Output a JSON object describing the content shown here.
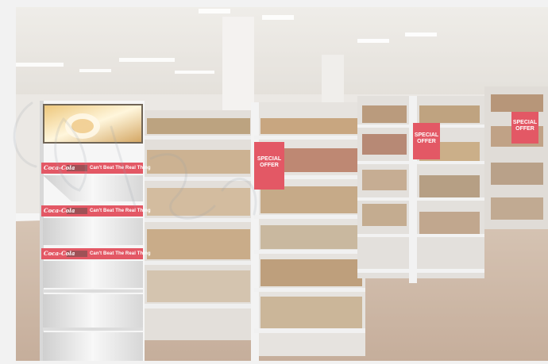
{
  "photo": {
    "subject": "supermarket aisle with display shelf",
    "colors": {
      "brand_red": "#d8182a",
      "floor": "#b79b82",
      "shelf": "#e8e8e8",
      "haze": "#ffffff"
    }
  },
  "shelf_banners": [
    {
      "brand": "Coca-Cola",
      "tagline": "Can't Beat The Real Thing"
    },
    {
      "brand": "Coca-Cola",
      "tagline": "Can't Beat The Real Thing"
    },
    {
      "brand": "Coca-Cola",
      "tagline": "Can't Beat The Real Thing"
    }
  ],
  "signs": [
    {
      "text": "SPECIAL\nOFFER"
    },
    {
      "text": "SPECIAL\nOFFER"
    },
    {
      "text": "SPECIAL\nOFFER"
    }
  ]
}
